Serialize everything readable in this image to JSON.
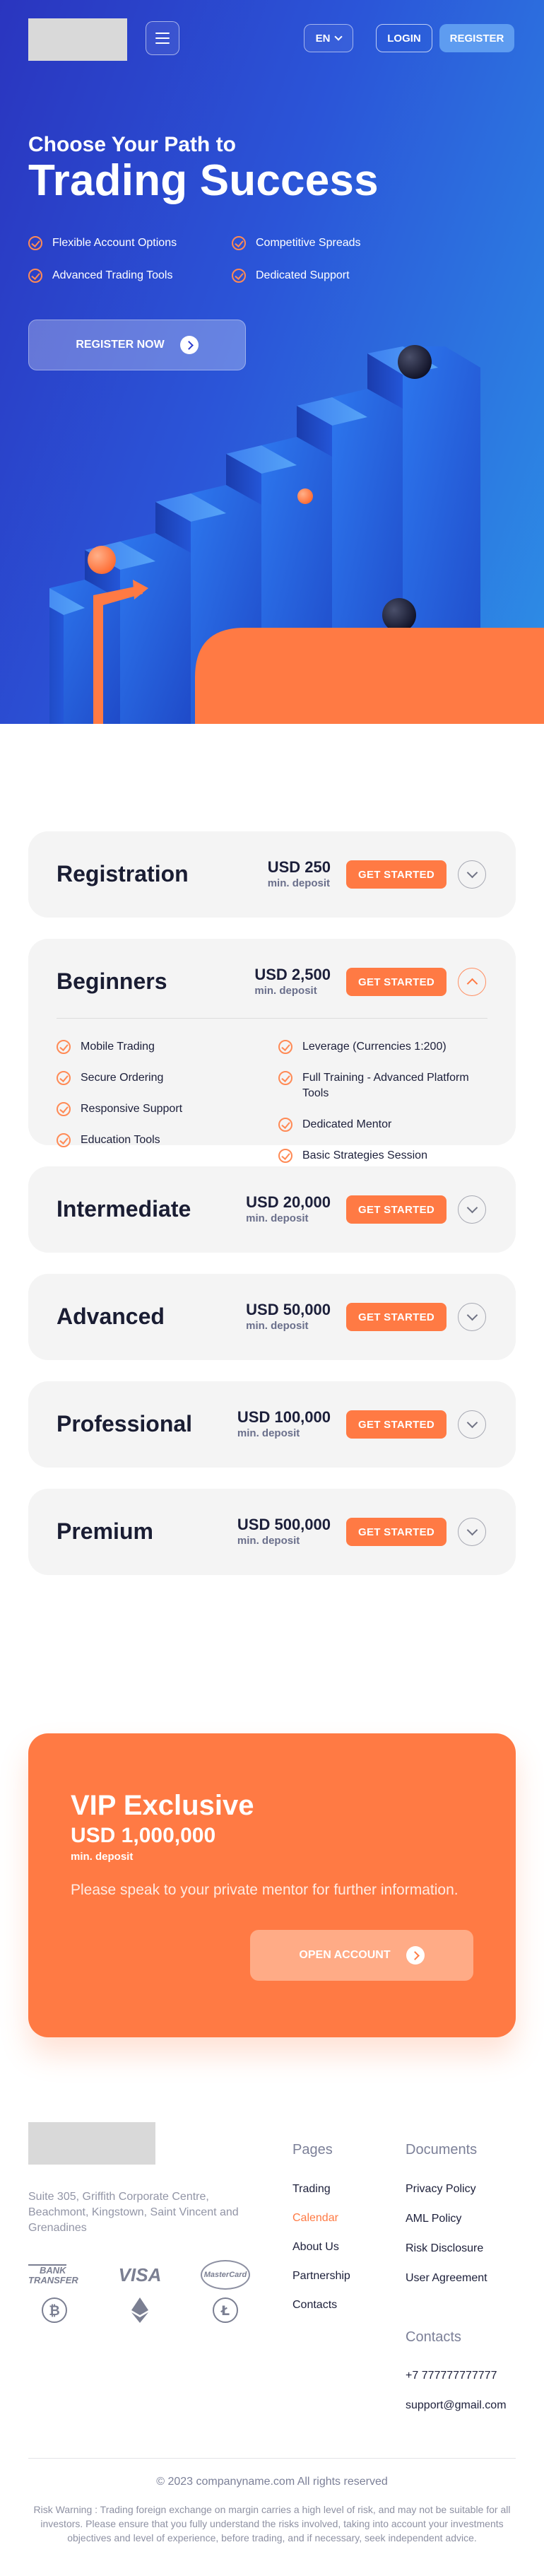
{
  "header": {
    "lang": "EN",
    "login": "LOGIN",
    "register": "REGISTER"
  },
  "hero": {
    "kicker": "Choose Your Path to",
    "title": "Trading Success",
    "features": [
      "Flexible Account Options",
      "Advanced Trading Tools",
      "Competitive Spreads",
      "Dedicated Support"
    ],
    "cta": "REGISTER NOW"
  },
  "colors": {
    "primary": "#2b3fcf",
    "accent": "#ff7a44",
    "card": "#f4f4f4"
  },
  "plans": [
    {
      "name": "Registration",
      "amount": "USD 250",
      "min": "min. deposit",
      "button": "GET STARTED",
      "expanded": false
    },
    {
      "name": "Beginners",
      "amount": "USD 2,500",
      "min": "min. deposit",
      "button": "GET STARTED",
      "expanded": true,
      "features_left": [
        "Mobile Trading",
        "Secure Ordering",
        "Responsive Support",
        "Education Tools"
      ],
      "features_right": [
        "Leverage (Currencies 1:200)",
        "Full Training - Advanced Platform Tools",
        "Dedicated Mentor",
        "Basic Strategies Session"
      ]
    },
    {
      "name": "Intermediate",
      "amount": "USD 20,000",
      "min": "min. deposit",
      "button": "GET STARTED",
      "expanded": false
    },
    {
      "name": "Advanced",
      "amount": "USD 50,000",
      "min": "min. deposit",
      "button": "GET STARTED",
      "expanded": false
    },
    {
      "name": "Professional",
      "amount": "USD 100,000",
      "min": "min. deposit",
      "button": "GET STARTED",
      "expanded": false
    },
    {
      "name": "Premium",
      "amount": "USD 500,000",
      "min": "min. deposit",
      "button": "GET STARTED",
      "expanded": false
    }
  ],
  "vip": {
    "title": "VIP Exclusive",
    "amount": "USD 1,000,000",
    "min": "min. deposit",
    "text": "Please speak to your private mentor for further information.",
    "button": "OPEN ACCOUNT"
  },
  "footer": {
    "address": "Suite 305, Griffith Corporate Centre, Beachmont, Kingstown, Saint Vincent and Grenadines",
    "payments": {
      "bank_line1": "BANK",
      "bank_line2": "TRANSFER",
      "visa": "VISA",
      "mastercard": "MasterCard",
      "crypto_icons": [
        "bitcoin-icon",
        "ethereum-icon",
        "litecoin-icon"
      ]
    },
    "pages_title": "Pages",
    "pages": [
      "Trading",
      "Calendar",
      "About Us",
      "Partnership",
      "Contacts"
    ],
    "active_page": "Calendar",
    "documents_title": "Documents",
    "documents": [
      "Privacy Policy",
      "AML Policy",
      "Risk Disclosure",
      "User Agreement"
    ],
    "contacts_title": "Contacts",
    "phone": "+7 777777777777",
    "email": "support@gmail.com",
    "copyright": "© 2023 companyname.com All rights reserved",
    "risk": "Risk Warning : Trading foreign exchange on margin carries a high level of risk, and may not be suitable for all investors. Please ensure that you fully understand the risks involved, taking into account your investments objectives and level of experience, before trading, and if necessary, seek independent advice."
  }
}
